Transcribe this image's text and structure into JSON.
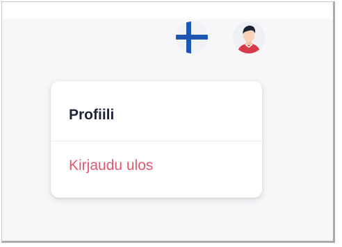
{
  "header": {
    "language_icon": "finland-flag-icon",
    "user_icon": "user-avatar-icon"
  },
  "dropdown": {
    "items": [
      {
        "label": "Profiili"
      },
      {
        "label": "Kirjaudu ulos",
        "color": "#e05a6e"
      }
    ]
  },
  "colors": {
    "background": "#f7f7f9",
    "text": "#1f2438",
    "danger": "#e05a6e",
    "flag_blue": "#1e56b3",
    "avatar_shirt": "#d93a4a"
  }
}
